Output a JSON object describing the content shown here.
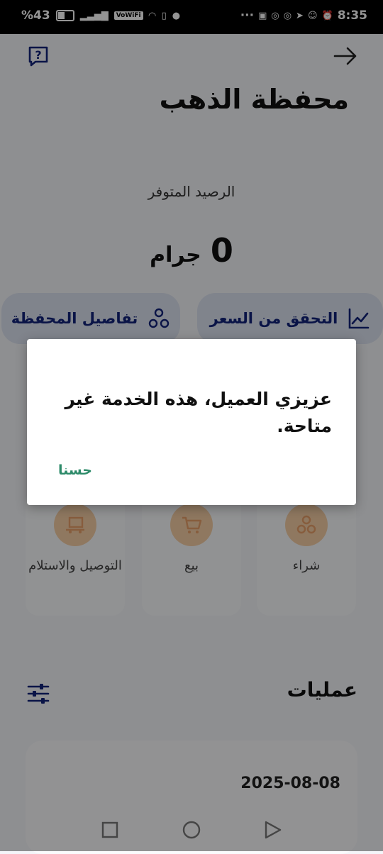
{
  "status_bar": {
    "battery": "%43",
    "network": "VoWiFi",
    "time": "8:35",
    "more": "···"
  },
  "header": {
    "title": "محفظة الذهب"
  },
  "balance": {
    "label": "الرصيد المتوفر",
    "value": "0",
    "unit": "جرام"
  },
  "actions": {
    "check_price": "التحقق من السعر",
    "wallet_details": "تفاصيل المحفظة"
  },
  "services": [
    {
      "label": "شراء",
      "icon": "coins-icon"
    },
    {
      "label": "بيع",
      "icon": "cart-icon"
    },
    {
      "label": "التوصيل والاستلام",
      "icon": "delivery-icon"
    }
  ],
  "operations": {
    "title": "عمليات",
    "transactions": [
      {
        "date": "2025-08-08"
      }
    ]
  },
  "dialog": {
    "message": "عزيزي العميل، هذه الخدمة غير متاحة.",
    "ok_label": "حسنا"
  },
  "colors": {
    "primary": "#12237a",
    "accent_button_bg": "#dde3f2",
    "service_circle": "#f6cfa6",
    "dialog_ok": "#2e8b6a"
  }
}
